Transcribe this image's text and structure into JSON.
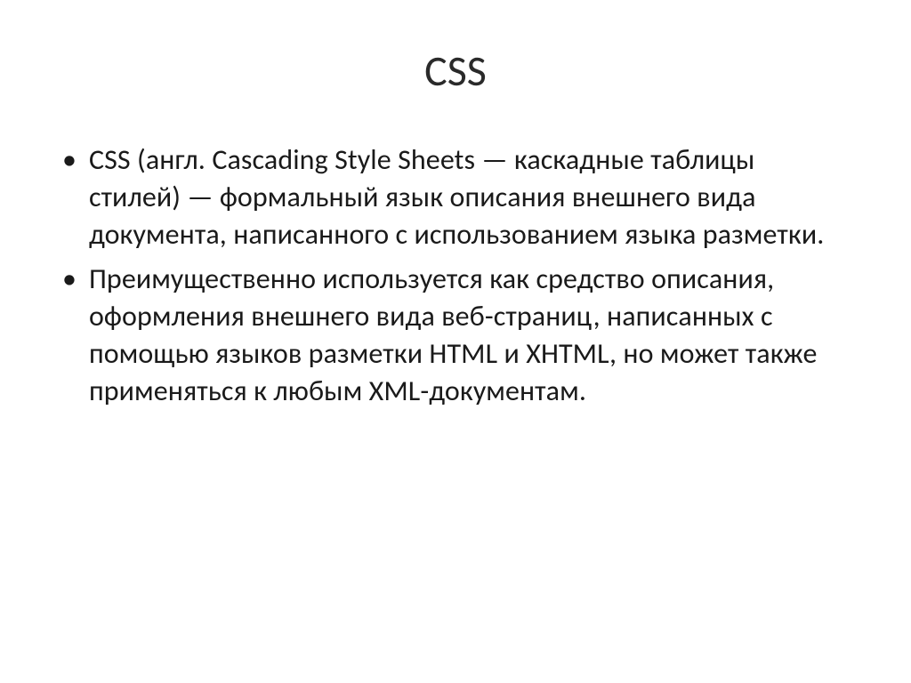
{
  "slide": {
    "title": "CSS",
    "bullets": [
      "CSS (англ. Cascading Style Sheets — каскадные таблицы стилей) — формальный язык описания внешнего вида документа, написанного с использованием языка разметки.",
      "Преимущественно используется как средство описания, оформления внешнего вида веб-страниц, написанных с помощью языков разметки HTML и XHTML, но может также применяться к любым XML-документам."
    ]
  }
}
